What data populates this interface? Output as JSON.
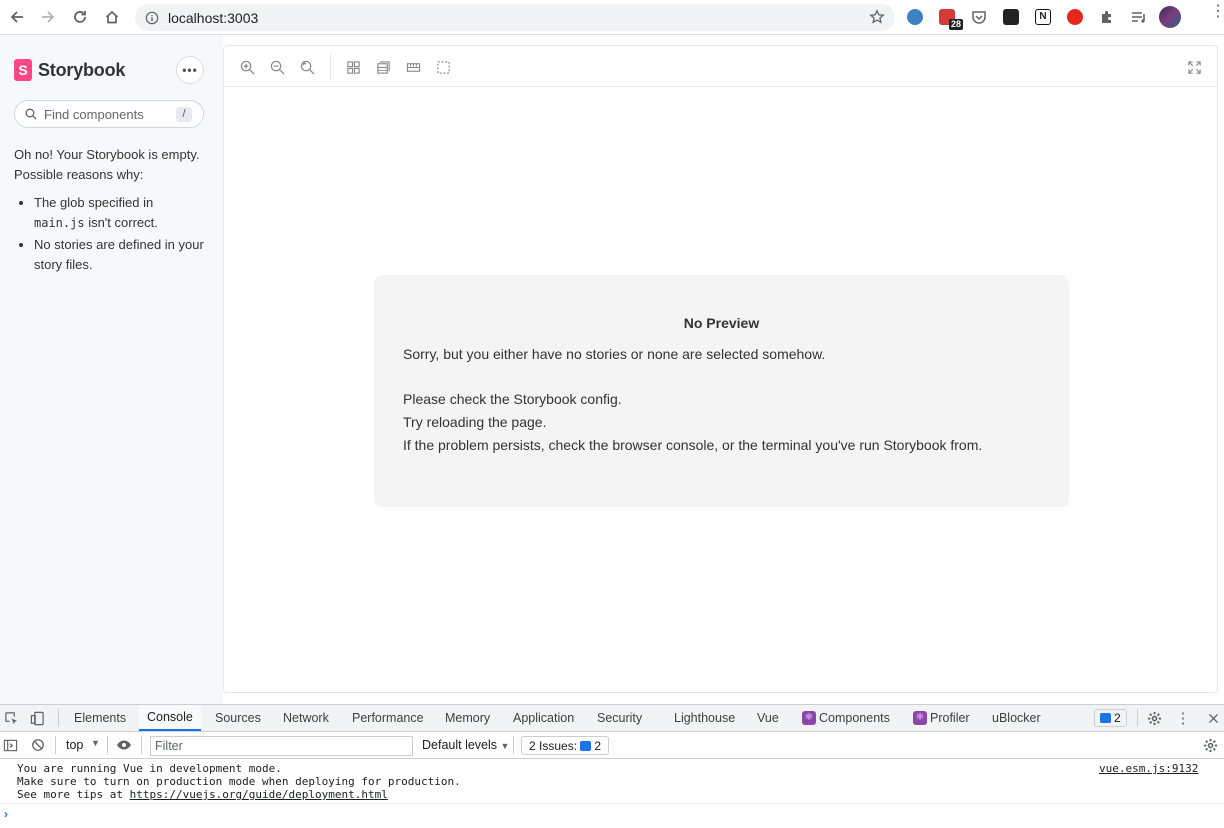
{
  "browser": {
    "url": "localhost:3003",
    "extensions": [
      {
        "name": "clock-extension",
        "color": "#3b82c4"
      },
      {
        "name": "todo-extension",
        "color": "#d63b3b",
        "badge": "28"
      },
      {
        "name": "pocket-extension",
        "color": "#5f6368"
      },
      {
        "name": "dark-extension",
        "color": "#222222"
      },
      {
        "name": "notion-extension",
        "color": "#111111"
      },
      {
        "name": "red-extension",
        "color": "#e5261f"
      }
    ]
  },
  "sidebar": {
    "brand": "Storybook",
    "brand_logo": "S",
    "menu_icon": "•••",
    "search_placeholder": "Find components",
    "search_shortcut": "/",
    "empty_intro": "Oh no! Your Storybook is empty. Possible reasons why:",
    "reasons": [
      {
        "pre": "The glob specified in ",
        "code": "main.js",
        "post": " isn't correct."
      },
      {
        "pre": "No stories are defined in your story files.",
        "code": "",
        "post": ""
      }
    ]
  },
  "preview": {
    "title": "No Preview",
    "line1": "Sorry, but you either have no stories or none are selected somehow.",
    "line2": "Please check the Storybook config.",
    "line3": "Try reloading the page.",
    "line4": "If the problem persists, check the browser console, or the terminal you've run Storybook from."
  },
  "devtools": {
    "tabs": [
      "Elements",
      "Console",
      "Sources",
      "Network",
      "Performance",
      "Memory",
      "Application",
      "Security",
      "Lighthouse",
      "Vue",
      "Components",
      "Profiler",
      "uBlocker"
    ],
    "active_tab": "Console",
    "issues_badge": "2",
    "context": "top",
    "filter_placeholder": "Filter",
    "levels": "Default levels",
    "issues_label": "2 Issues:",
    "issues_count": "2",
    "console_line1": "You are running Vue in development mode.",
    "console_line2": "Make sure to turn on production mode when deploying for production.",
    "console_line3_pre": "See more tips at ",
    "console_link": "https://vuejs.org/guide/deployment.html",
    "source": "vue.esm.js:9132",
    "prompt": "›"
  }
}
